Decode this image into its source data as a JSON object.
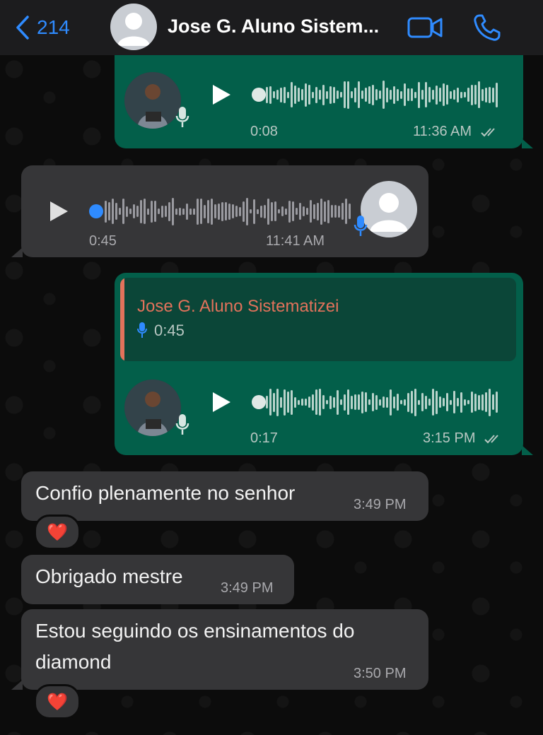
{
  "header": {
    "back_count": "214",
    "contact_name": "Jose G. Aluno Sistem...",
    "accent": "#2f8bff"
  },
  "messages": {
    "voice1": {
      "duration": "0:08",
      "time": "11:36 AM"
    },
    "voice2": {
      "duration": "0:45",
      "time": "11:41 AM"
    },
    "reply": {
      "quoted_name": "Jose G. Aluno Sistematizei",
      "quoted_duration": "0:45",
      "duration": "0:17",
      "time": "3:15 PM"
    },
    "text1": {
      "text": "Confio plenamente no senhor",
      "time": "3:49 PM",
      "reaction": "❤️"
    },
    "text2": {
      "text": "Obrigado mestre",
      "time": "3:49 PM"
    },
    "text3": {
      "line1": "Estou seguindo os ensinamentos do",
      "line2": "diamond",
      "time": "3:50 PM",
      "reaction": "❤️"
    }
  },
  "colors": {
    "outgoing_bubble": "#035f4a",
    "incoming_bubble": "#363638",
    "quote_name": "#e2725b",
    "mic_blue": "#2f8bff"
  },
  "icons": [
    "chevron-left-icon",
    "video-call-icon",
    "phone-icon",
    "play-icon",
    "mic-icon",
    "read-ticks-icon",
    "heart-reaction"
  ]
}
